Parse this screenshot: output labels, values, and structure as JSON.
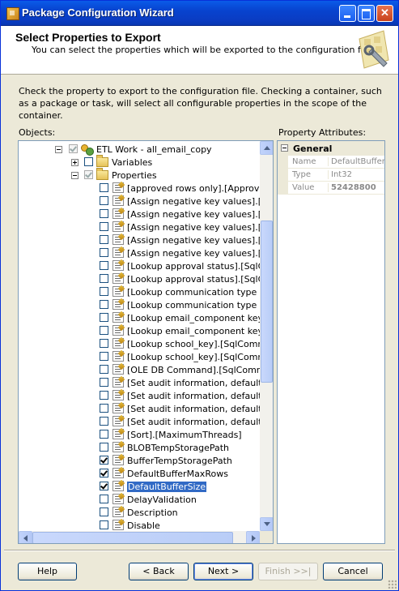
{
  "window": {
    "title": "Package Configuration Wizard"
  },
  "header": {
    "title": "Select Properties to Export",
    "subtitle": "You can select the properties which will be exported to the configuration file."
  },
  "description": "Check the property to export to the configuration file. Checking a container, such as a package or task, will select all configurable properties in the scope of the container.",
  "objects_label": "Objects:",
  "property_attributes_label": "Property Attributes:",
  "tree": {
    "root": {
      "label": "ETL Work - all_email_copy",
      "checked": "partial"
    },
    "variables": {
      "label": "Variables",
      "checked": false
    },
    "properties": {
      "label": "Properties",
      "checked": "partial"
    },
    "items": [
      {
        "label": "[approved rows only].[Approved]",
        "checked": false,
        "icon": "property-icon"
      },
      {
        "label": "[Assign negative key values].[Der",
        "checked": false,
        "icon": "property-icon"
      },
      {
        "label": "[Assign negative key values].[Der",
        "checked": false,
        "icon": "property-icon"
      },
      {
        "label": "[Assign negative key values].[Der",
        "checked": false,
        "icon": "property-icon"
      },
      {
        "label": "[Assign negative key values].[Der",
        "checked": false,
        "icon": "property-icon"
      },
      {
        "label": "[Assign negative key values].[Der",
        "checked": false,
        "icon": "property-icon"
      },
      {
        "label": "[Lookup approval status].[SqlCom",
        "checked": false,
        "icon": "property-icon"
      },
      {
        "label": "[Lookup approval status].[SqlCom",
        "checked": false,
        "icon": "property-icon"
      },
      {
        "label": "[Lookup communication type key].",
        "checked": false,
        "icon": "property-icon"
      },
      {
        "label": "[Lookup communication type key].",
        "checked": false,
        "icon": "property-icon"
      },
      {
        "label": "[Lookup email_component key].[S",
        "checked": false,
        "icon": "property-icon"
      },
      {
        "label": "[Lookup email_component key].[S",
        "checked": false,
        "icon": "property-icon"
      },
      {
        "label": "[Lookup school_key].[SqlComman",
        "checked": false,
        "icon": "property-icon"
      },
      {
        "label": "[Lookup school_key].[SqlComman",
        "checked": false,
        "icon": "property-icon"
      },
      {
        "label": "[OLE DB Command].[SqlCommand",
        "checked": false,
        "icon": "property-icon"
      },
      {
        "label": "[Set audit information, default info",
        "checked": false,
        "icon": "property-icon"
      },
      {
        "label": "[Set audit information, default info",
        "checked": false,
        "icon": "property-icon"
      },
      {
        "label": "[Set audit information, default info",
        "checked": false,
        "icon": "property-icon"
      },
      {
        "label": "[Set audit information, default info",
        "checked": false,
        "icon": "property-icon"
      },
      {
        "label": "[Sort].[MaximumThreads]",
        "checked": false,
        "icon": "property-icon"
      },
      {
        "label": "BLOBTempStoragePath",
        "checked": false,
        "icon": "property-icon"
      },
      {
        "label": "BufferTempStoragePath",
        "checked": true,
        "icon": "property-icon"
      },
      {
        "label": "DefaultBufferMaxRows",
        "checked": true,
        "icon": "property-icon"
      },
      {
        "label": "DefaultBufferSize",
        "checked": true,
        "icon": "property-icon",
        "selected": true
      },
      {
        "label": "DelayValidation",
        "checked": false,
        "icon": "property-icon"
      },
      {
        "label": "Description",
        "checked": false,
        "icon": "property-icon"
      },
      {
        "label": "Disable",
        "checked": false,
        "icon": "property-icon"
      }
    ]
  },
  "property_grid": {
    "category": "General",
    "rows": [
      {
        "key": "Name",
        "value": "DefaultBufferS"
      },
      {
        "key": "Type",
        "value": "Int32"
      },
      {
        "key": "Value",
        "value": "52428800"
      }
    ]
  },
  "buttons": {
    "help": "Help",
    "back": "< Back",
    "next": "Next >",
    "finish": "Finish >>|",
    "cancel": "Cancel"
  }
}
